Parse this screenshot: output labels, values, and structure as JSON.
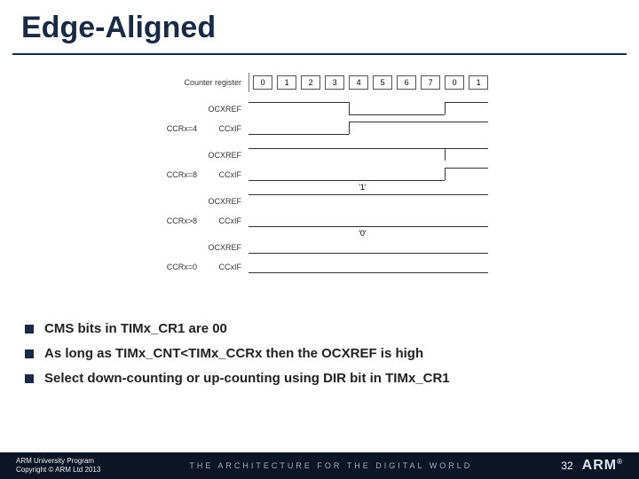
{
  "title": "Edge-Aligned",
  "diagram": {
    "counter_label": "Counter register",
    "counter_cells": [
      "0",
      "1",
      "2",
      "3",
      "4",
      "5",
      "6",
      "7",
      "0",
      "1"
    ],
    "groups": [
      {
        "ccr_label": "CCRx=4",
        "ocxref": "OCXREF",
        "cxif": "CCxIF",
        "pm": ""
      },
      {
        "ccr_label": "CCRx=8",
        "ocxref": "OCXREF",
        "cxif": "CCxIF",
        "pm": ""
      },
      {
        "ccr_label": "CCRx>8",
        "ocxref": "OCXREF",
        "cxif": "CCxIF",
        "pm": "'1'"
      },
      {
        "ccr_label": "CCRx=0",
        "ocxref": "OCXREF",
        "cxif": "CCxIF",
        "pm": "'0'"
      }
    ]
  },
  "bullets": [
    "CMS bits in TIMx_CR1 are 00",
    "As long as TIMx_CNT<TIMx_CCRx then the OCXREF is high",
    "Select down-counting or up-counting using DIR bit in TIMx_CR1"
  ],
  "footer": {
    "line1": "ARM University Program",
    "line2": "Copyright © ARM Ltd 2013",
    "tagline": "THE ARCHITECTURE FOR THE DIGITAL WORLD",
    "page": "32",
    "logo": "ARM"
  }
}
